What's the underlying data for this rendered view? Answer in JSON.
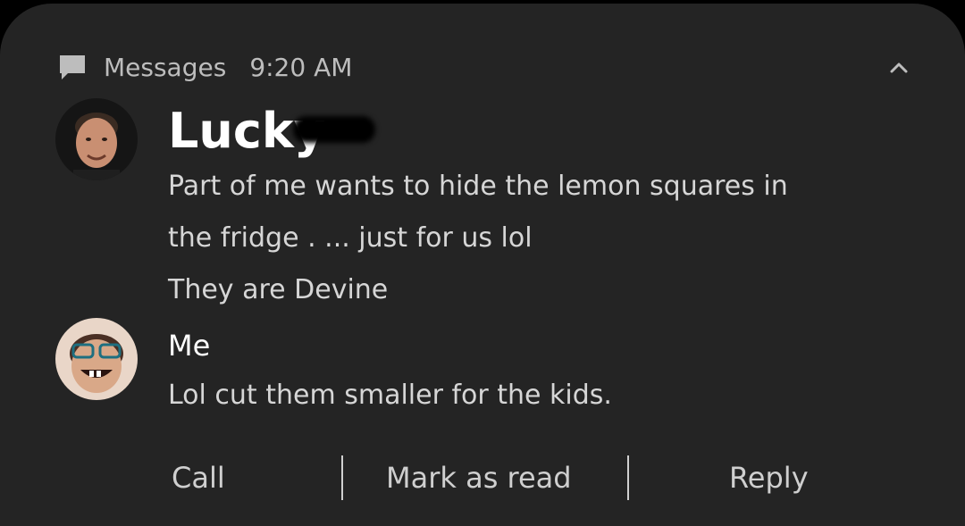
{
  "notification": {
    "app_name": "Messages",
    "time": "9:20 AM",
    "collapse_icon": "chevron-up-icon",
    "app_icon": "chat-bubble-icon"
  },
  "messages": [
    {
      "sender": "Lucky",
      "avatar": "avatar-man",
      "lines": [
        "Part of me wants to hide the lemon squares in",
        "the fridge . ... just for us lol",
        "They are Devine"
      ]
    },
    {
      "sender": "Me",
      "avatar": "avatar-woman",
      "lines": [
        "Lol cut them smaller for the kids."
      ]
    }
  ],
  "actions": {
    "call": "Call",
    "mark_as_read": "Mark as read",
    "reply": "Reply"
  },
  "colors": {
    "card_bg": "#242424",
    "screen_bg": "#000000",
    "text_primary": "#ffffff",
    "text_secondary": "#bdbdbd"
  }
}
